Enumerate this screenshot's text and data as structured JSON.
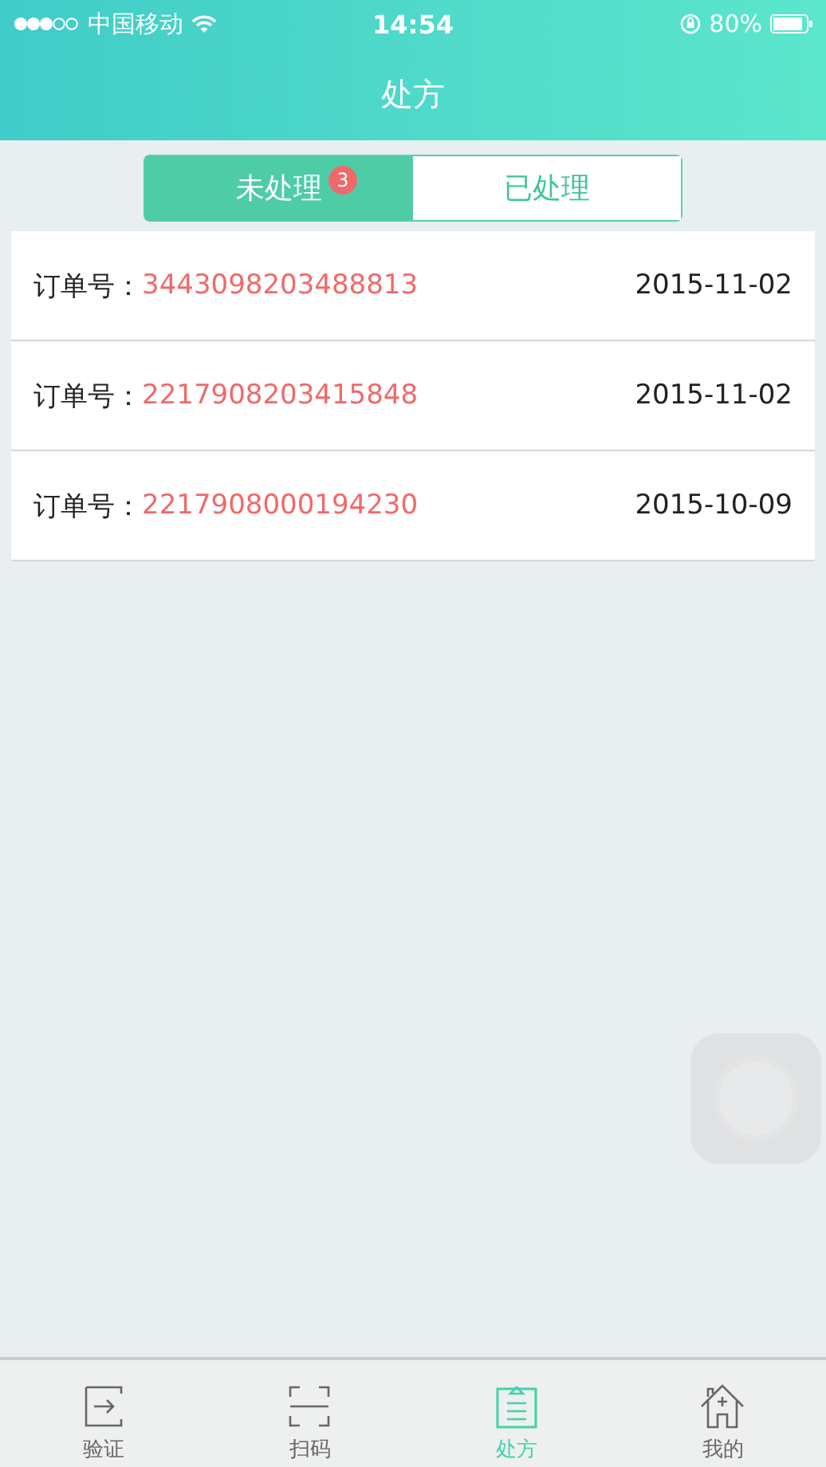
{
  "status_bar": {
    "carrier": "中国移动",
    "time": "14:54",
    "battery": "80%"
  },
  "nav": {
    "title": "处方"
  },
  "tabs": [
    {
      "label": "未处理",
      "badge": "3",
      "selected": true
    },
    {
      "label": "已处理",
      "selected": false
    }
  ],
  "orders": [
    {
      "label": "订单号：",
      "number": "3443098203488813",
      "date": "2015-11-02"
    },
    {
      "label": "订单号：",
      "number": "2217908203415848",
      "date": "2015-11-02"
    },
    {
      "label": "订单号：",
      "number": "2217908000194230",
      "date": "2015-10-09"
    }
  ],
  "tab_bar": [
    {
      "label": "验证",
      "kind": "verify",
      "selected": false
    },
    {
      "label": "扫码",
      "kind": "scan",
      "selected": false
    },
    {
      "label": "处方",
      "kind": "prescription",
      "selected": true
    },
    {
      "label": "我的",
      "kind": "home",
      "selected": false
    }
  ]
}
